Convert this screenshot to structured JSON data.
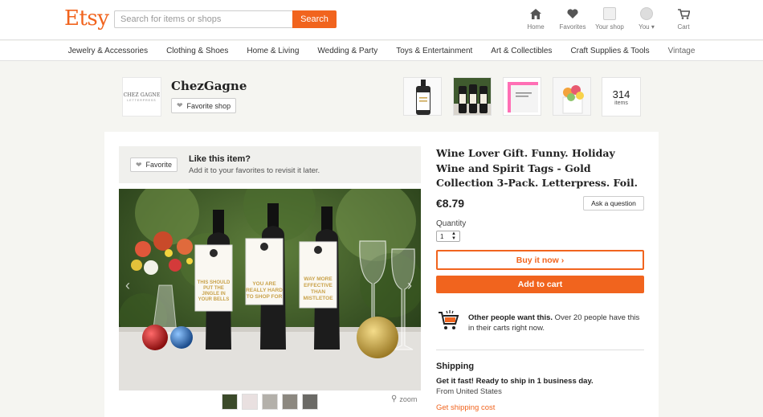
{
  "header": {
    "logo": "Etsy",
    "search_placeholder": "Search for items or shops",
    "search_button": "Search",
    "nav": [
      {
        "label": "Home",
        "icon": "home-icon"
      },
      {
        "label": "Favorites",
        "icon": "heart-icon"
      },
      {
        "label": "Your shop",
        "icon": "shop-icon"
      },
      {
        "label": "You ▾",
        "icon": "avatar-icon"
      },
      {
        "label": "Cart",
        "icon": "cart-icon"
      }
    ]
  },
  "categories": [
    "Jewelry & Accessories",
    "Clothing & Shoes",
    "Home & Living",
    "Wedding & Party",
    "Toys & Entertainment",
    "Art & Collectibles",
    "Craft Supplies & Tools",
    "Vintage"
  ],
  "shop": {
    "logo_line1": "CHEZ GAGNE",
    "logo_line2": "LETTERPRESS",
    "name": "ChezGagne",
    "favorite_label": "Favorite shop",
    "item_count": "314",
    "item_count_label": "items"
  },
  "like_box": {
    "favorite_label": "Favorite",
    "title": "Like this item?",
    "subtitle": "Add it to your favorites to revisit it later."
  },
  "photo": {
    "tag1": "THIS SHOULD PUT THE JINGLE IN YOUR BELLS",
    "tag2": "YOU ARE REALLY HARD TO SHOP FOR",
    "tag3": "WAY MORE EFFECTIVE THAN MISTLETOE",
    "zoom_label": "zoom"
  },
  "listing": {
    "title": "Wine Lover Gift. Funny. Holiday Wine and Spirit Tags - Gold Collection 3-Pack. Letterpress. Foil.",
    "price": "€8.79",
    "ask_label": "Ask a question",
    "quantity_label": "Quantity",
    "quantity_value": "1",
    "buy_now_label": "Buy it now ›",
    "add_cart_label": "Add to cart",
    "others_bold": "Other people want this.",
    "others_text": " Over 20 people have this in their carts right now."
  },
  "shipping": {
    "title": "Shipping",
    "fast": "Get it fast! Ready to ship in 1 business day.",
    "from": "From United States",
    "cost_link": "Get shipping cost"
  },
  "colors": {
    "accent": "#f1641e"
  }
}
